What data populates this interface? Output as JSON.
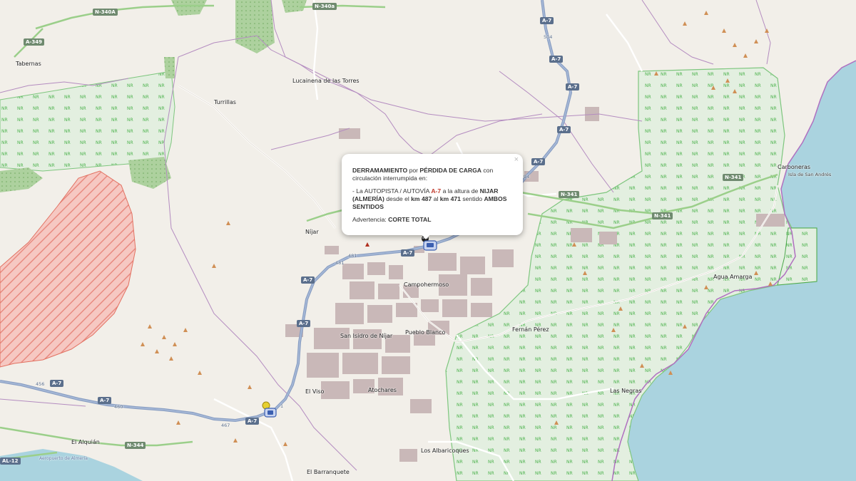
{
  "map": {
    "places": [
      {
        "name": "Tabernas"
      },
      {
        "name": "Lucainena de las Torres"
      },
      {
        "name": "Turrillas"
      },
      {
        "name": "Carboneras"
      },
      {
        "name": "Isla de San Andrés"
      },
      {
        "name": "Níjar"
      },
      {
        "name": "Campohermoso"
      },
      {
        "name": "San Isidro de Níjar"
      },
      {
        "name": "Pueblo Blanco"
      },
      {
        "name": "Fernán Pérez"
      },
      {
        "name": "Agua Amarga"
      },
      {
        "name": "El Viso"
      },
      {
        "name": "Atochares"
      },
      {
        "name": "Las Negras"
      },
      {
        "name": "El Alquián"
      },
      {
        "name": "Los Albaricoques"
      },
      {
        "name": "El Barranquete"
      },
      {
        "name": "Aeropuerto de Almería"
      }
    ],
    "shields": [
      "N-340A",
      "N-340a",
      "A-349",
      "A-7",
      "A-7",
      "A-7",
      "A-7",
      "N-341",
      "N-341",
      "N-341",
      "A-7",
      "A-7",
      "A-7",
      "A-7",
      "A-7",
      "A-7",
      "A-7",
      "N-344",
      "AL-12"
    ],
    "road_numbers": [
      "504",
      "94",
      "481",
      "481",
      "456",
      "460",
      "467",
      "1"
    ],
    "protected_label": "NR",
    "colors": {
      "land": "#f2efe9",
      "sea": "#aad3df",
      "protected_fill": "#e3efe0",
      "protected_border": "#7ec67e",
      "forest": "#add19e",
      "military": "#f07070",
      "farmland": "#c9b8b8",
      "highway": "#8a9fc3",
      "boundary": "#b48cc0",
      "peak": "#d08f55"
    }
  },
  "popup": {
    "close": "×",
    "line1_a": "DERRAMAMIENTO",
    "line1_b": " por ",
    "line1_c": "PÉRDIDA DE CARGA",
    "line1_d": " con circulación interrumpida en:",
    "line2_a": "- La AUTOPISTA / AUTOVÍA ",
    "line2_road": "A-7",
    "line2_b": " a la altura de ",
    "line2_c": "NIJAR (ALMERÍA)",
    "line2_d": " desde el ",
    "line2_km1": "km 487",
    "line2_e": " al ",
    "line2_km2": "km 471",
    "line2_f": " sentido ",
    "line2_dir": "AMBOS SENTIDOS",
    "line3_a": "Advertencia: ",
    "line3_b": "CORTE TOTAL"
  }
}
